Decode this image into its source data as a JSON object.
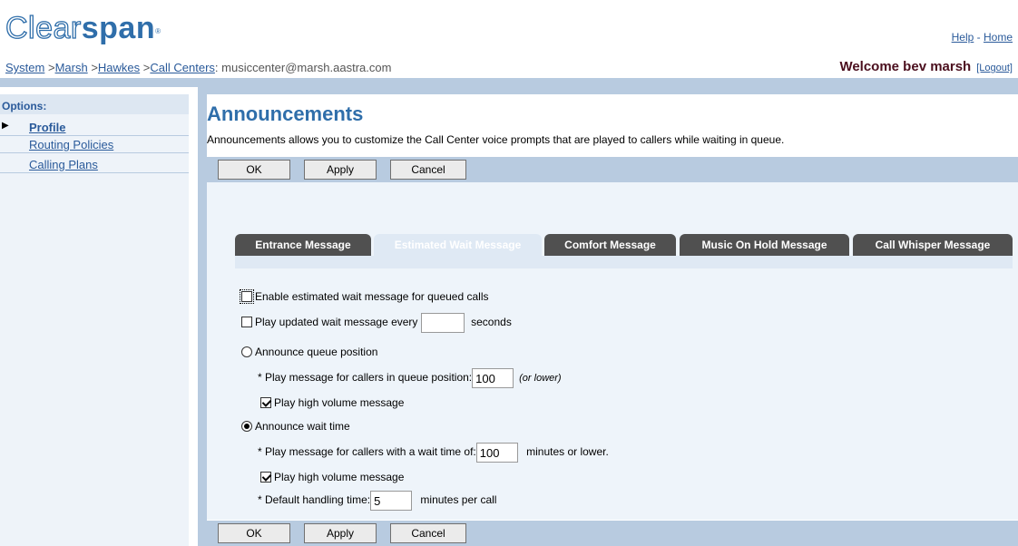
{
  "header": {
    "logo_part1": "Clear",
    "logo_part2": "span",
    "logo_reg": "®",
    "help": "Help",
    "link_sep": " - ",
    "home": "Home",
    "breadcrumb": [
      {
        "label": "System",
        "link": true
      },
      {
        "label": "Marsh",
        "link": true
      },
      {
        "label": "Hawkes",
        "link": true
      },
      {
        "label": "Call Centers",
        "link": true
      },
      {
        "label": ": musiccenter@marsh.aastra.com",
        "link": false
      }
    ],
    "welcome": "Welcome bev marsh",
    "logout": "[Logout]"
  },
  "sidebar": {
    "title": "Options:",
    "items": [
      {
        "label": "Profile",
        "active": true
      },
      {
        "label": "Routing Policies",
        "active": false
      },
      {
        "label": "Calling Plans",
        "active": false
      }
    ]
  },
  "page": {
    "title": "Announcements",
    "description": "Announcements allows you to customize the Call Center voice prompts that are played to callers while waiting in queue."
  },
  "buttons": {
    "ok": "OK",
    "apply": "Apply",
    "cancel": "Cancel"
  },
  "tabs": [
    {
      "label": "Entrance Message",
      "active": false
    },
    {
      "label": "Estimated Wait Message",
      "active": true
    },
    {
      "label": "Comfort Message",
      "active": false
    },
    {
      "label": "Music On Hold Message",
      "active": false
    },
    {
      "label": "Call Whisper Message",
      "active": false
    }
  ],
  "form": {
    "enable_label": "Enable estimated wait message for queued calls",
    "enable_checked": false,
    "play_updated_label": "Play updated wait message every",
    "play_updated_value": "",
    "play_updated_unit": "seconds",
    "announce_position_label": "Announce queue position",
    "position_prompt": "* Play message for callers in queue position:",
    "position_value": "100",
    "position_hint": "(or lower)",
    "position_high_volume": "Play high volume message",
    "announce_wait_label": "Announce wait time",
    "wait_prompt": "* Play message for callers with a wait time of:",
    "wait_value": "100",
    "wait_unit": "minutes or lower.",
    "wait_high_volume": "Play high volume message",
    "default_handling_prompt": "* Default handling time:",
    "default_handling_value": "5",
    "default_handling_unit": "minutes per call"
  },
  "colors": {
    "brand": "#2f6eaa",
    "bar": "#b8cbe0",
    "tab_dark": "#505050",
    "welcome": "#4b0f1e"
  }
}
